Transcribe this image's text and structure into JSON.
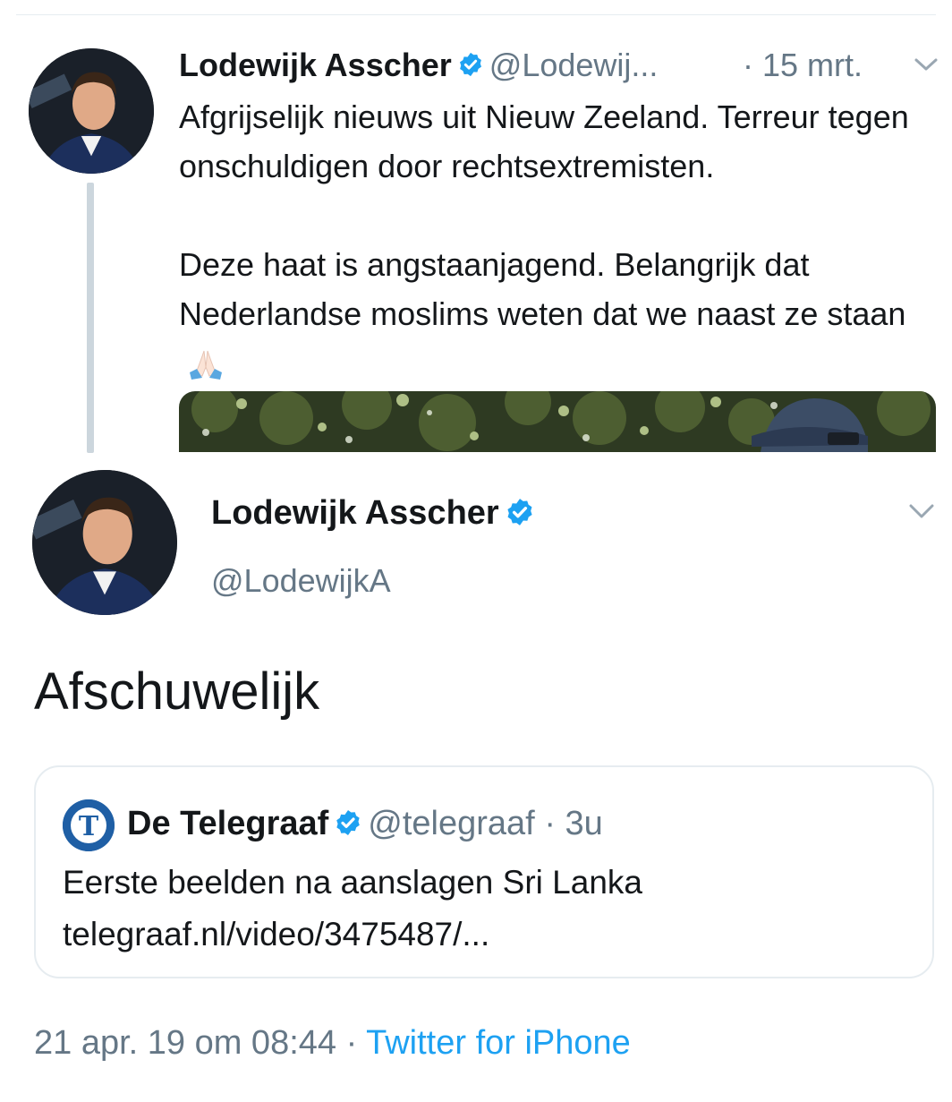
{
  "colors": {
    "verified": "#1da1f2",
    "link": "#1da1f2",
    "muted": "#657786",
    "text": "#14171a"
  },
  "tweet1": {
    "name": "Lodewijk Asscher",
    "handle": "@Lodewij...",
    "separator": "·",
    "time": "15 mrt.",
    "paragraph1": "Afgrijselijk nieuws uit Nieuw Zeeland. Terreur tegen onschuldigen door rechtsextremisten.",
    "paragraph2": "Deze haat is angstaanjagend. Belangrijk dat Nederlandse moslims weten dat we naast ze staan",
    "emoji": "folded-hands-emoji"
  },
  "tweet2": {
    "name": "Lodewijk Asscher",
    "handle": "@LodewijkA",
    "body": "Afschuwelijk",
    "timestamp": "21 apr. 19 om 08:44",
    "separator": "·",
    "source": "Twitter for iPhone"
  },
  "quote": {
    "name": "De Telegraaf",
    "handle": "@telegraaf",
    "separator": "·",
    "time": "3u",
    "line1": "Eerste beelden na aanslagen Sri Lanka",
    "line2": "telegraaf.nl/video/3475487/..."
  }
}
